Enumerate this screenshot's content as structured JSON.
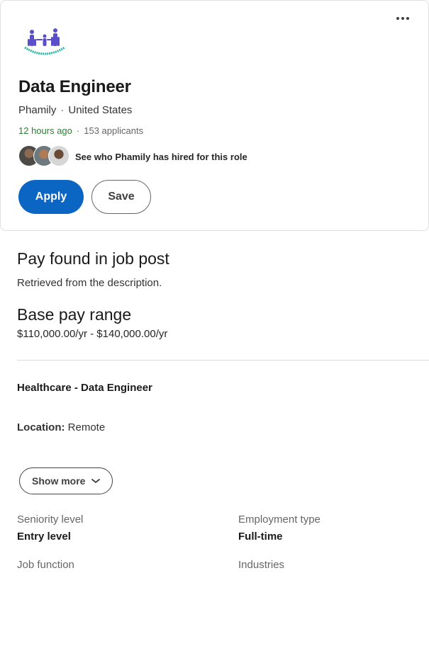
{
  "job": {
    "title": "Data Engineer",
    "company": "Phamily",
    "location": "United States",
    "posted": "12 hours ago",
    "applicants": "153 applicants",
    "hired_link": "See who Phamily has hired for this role"
  },
  "actions": {
    "apply_label": "Apply",
    "save_label": "Save",
    "more_icon": "more-horizontal-icon"
  },
  "pay": {
    "heading": "Pay found in job post",
    "source": "Retrieved from the description.",
    "range_heading": "Base pay range",
    "range_value": "$110,000.00/yr - $140,000.00/yr"
  },
  "description": {
    "heading": "Healthcare - Data Engineer",
    "location_label": "Location:",
    "location_value": "Remote",
    "show_more_label": "Show more",
    "show_more_icon": "chevron-down-icon"
  },
  "criteria": [
    {
      "label": "Seniority level",
      "value": "Entry level"
    },
    {
      "label": "Employment type",
      "value": "Full-time"
    },
    {
      "label": "Job function"
    },
    {
      "label": "Industries"
    }
  ],
  "colors": {
    "accent": "#0a66c2",
    "posted_green": "#2f7d32",
    "logo_purple": "#5b4fc9",
    "logo_teal": "#2bb5a0"
  }
}
